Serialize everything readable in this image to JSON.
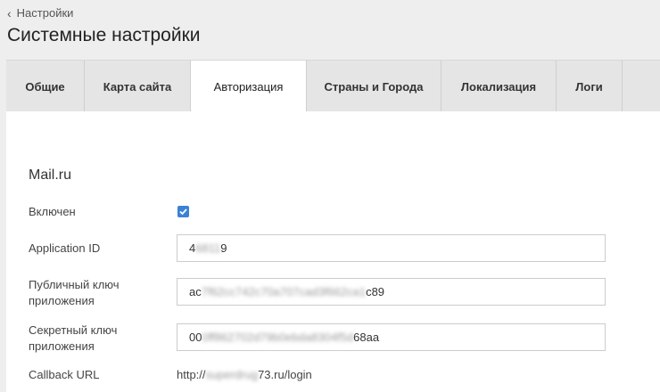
{
  "header": {
    "back_label": "Настройки",
    "title": "Системные настройки"
  },
  "tabs": [
    {
      "label": "Общие"
    },
    {
      "label": "Карта сайта"
    },
    {
      "label": "Авторизация"
    },
    {
      "label": "Страны и Города"
    },
    {
      "label": "Локализация"
    },
    {
      "label": "Логи"
    }
  ],
  "active_tab": "Авторизация",
  "section": {
    "title": "Mail.ru",
    "enabled_label": "Включен",
    "enabled": true,
    "application_id": {
      "label": "Application ID",
      "value_start": "4",
      "value_hidden": "6811",
      "value_end": "9"
    },
    "public_key": {
      "label": "Публичный ключ приложения",
      "value_start": "ac",
      "value_hidden": "7f62cc742c70a707cad3f662ca1",
      "value_end": "c89"
    },
    "secret_key": {
      "label": "Секретный ключ приложения",
      "value_start": "00",
      "value_hidden": "0ff862702d79b0ebda8304f5d",
      "value_end": "68aa"
    },
    "callback_url": {
      "label": "Callback URL",
      "value_start": "http://",
      "value_hidden": "superdrug",
      "value_end": "73.ru/login"
    }
  },
  "colors": {
    "page_bg": "#eeeeee",
    "tab_bg": "#e5e5e5",
    "active_tab_bg": "#ffffff",
    "checkbox_accent": "#3b82d6"
  }
}
